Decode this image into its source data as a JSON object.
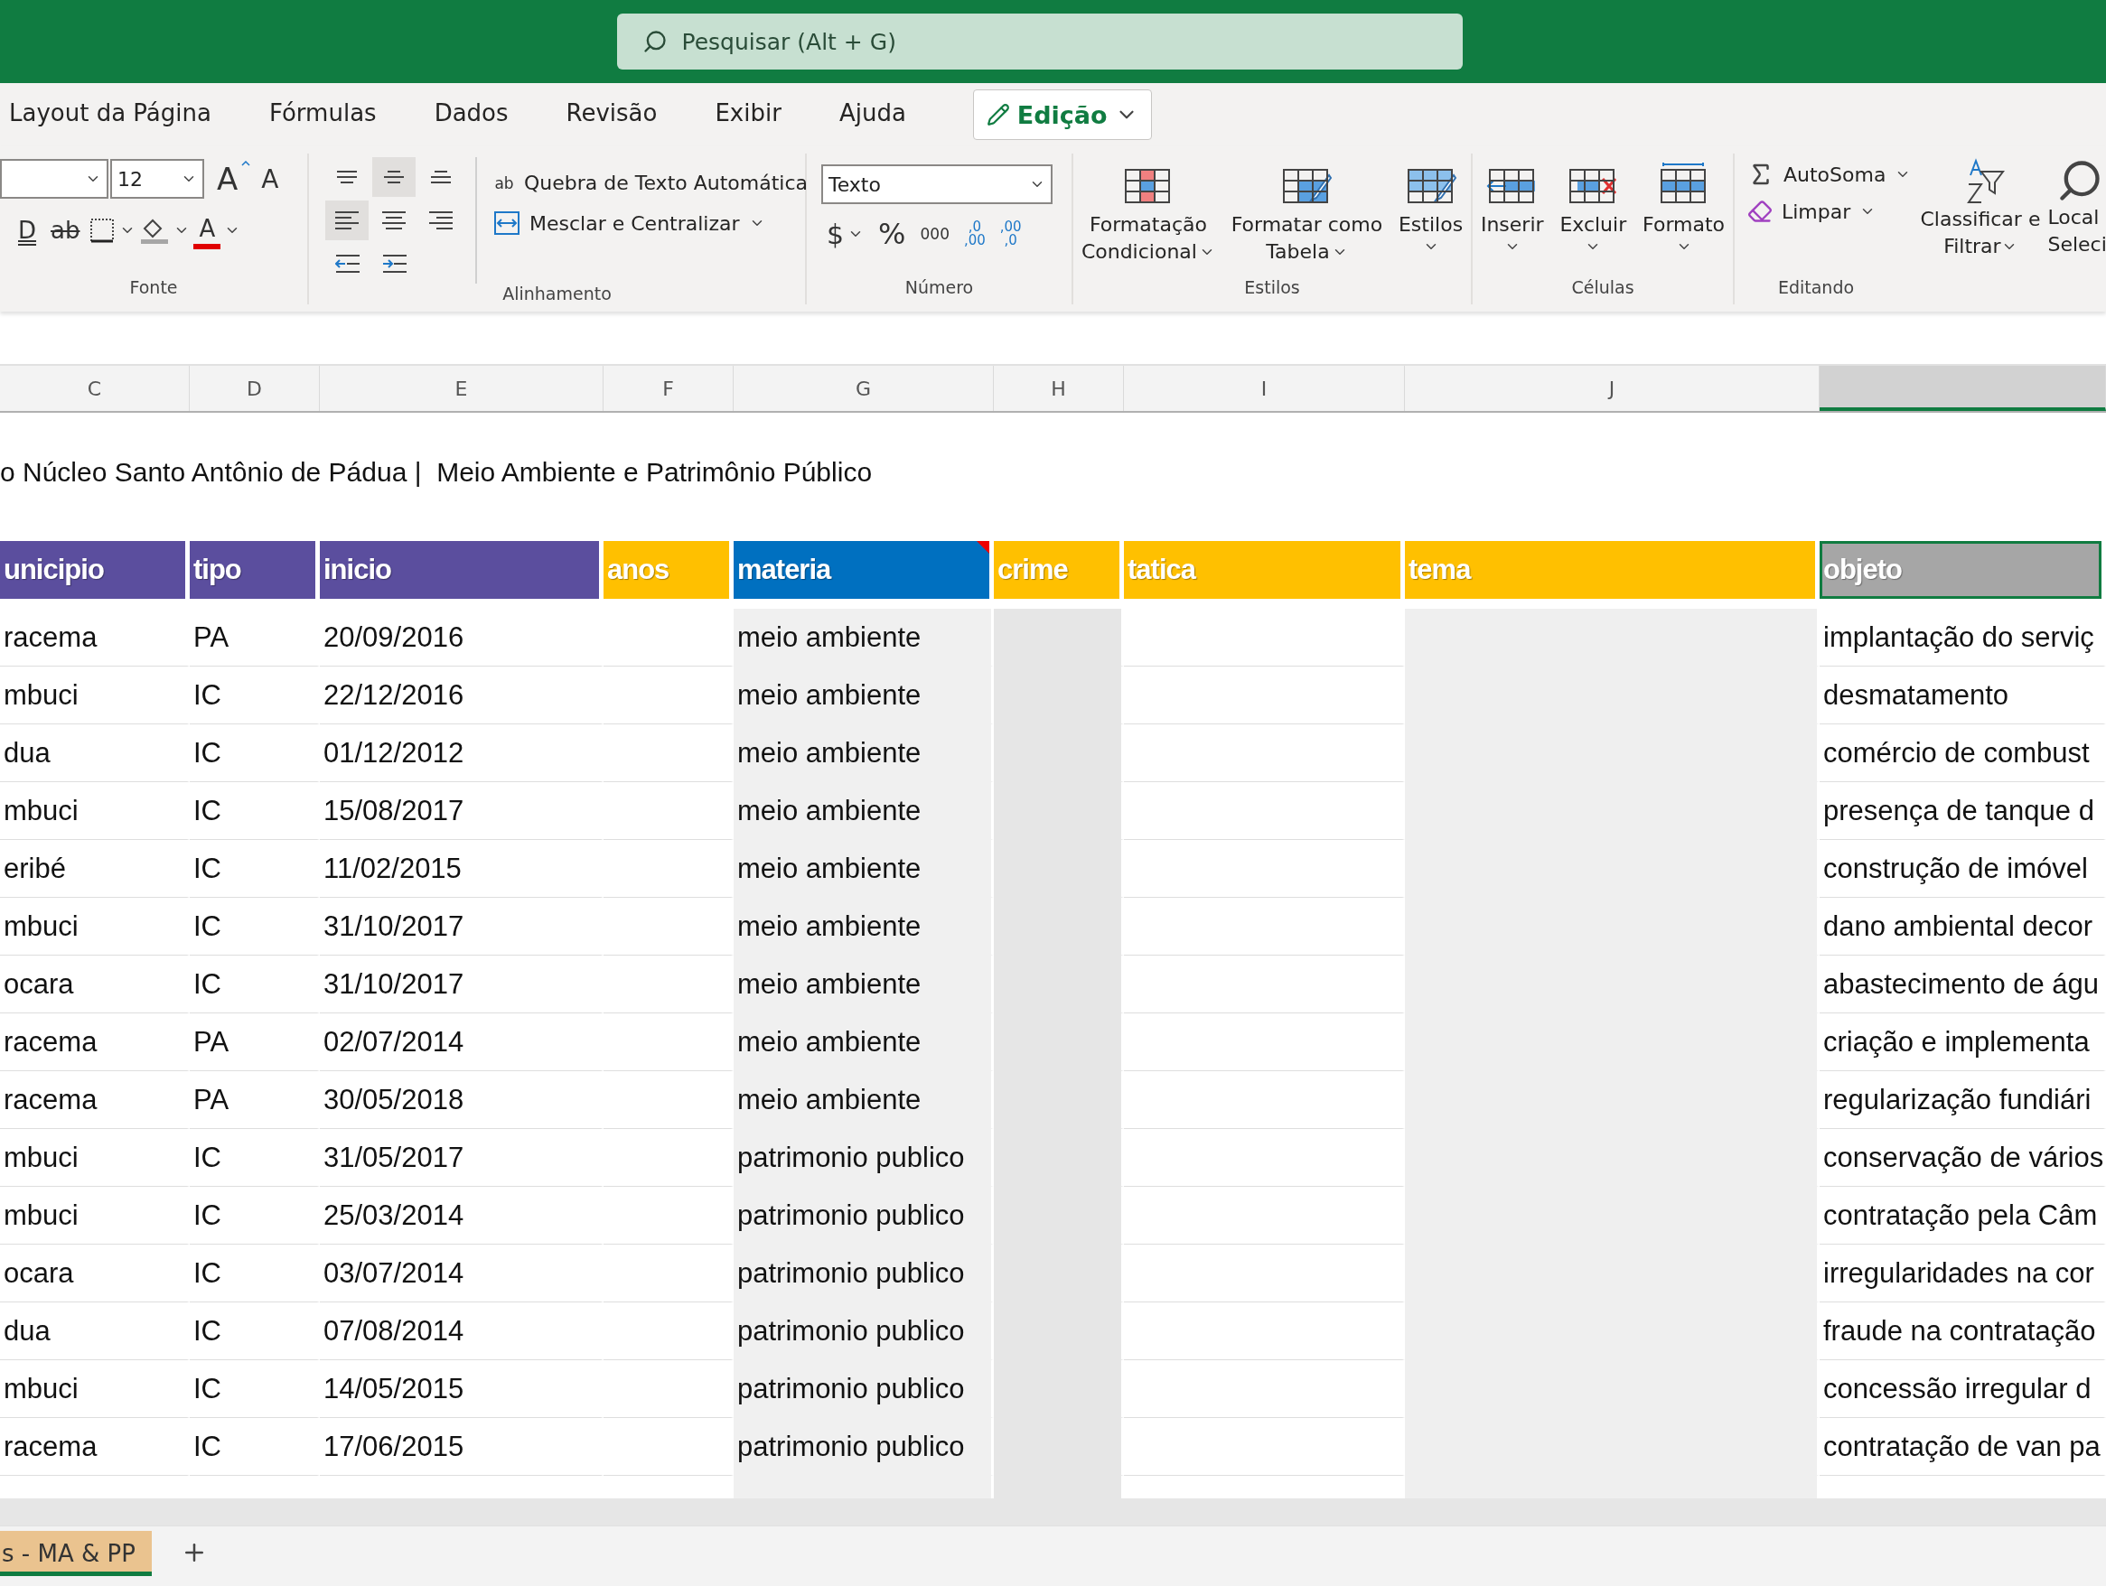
{
  "search": {
    "placeholder": "Pesquisar (Alt + G)"
  },
  "menu": {
    "tabs": [
      {
        "label": "Layout da Página",
        "selected": false
      },
      {
        "label": "Fórmulas",
        "selected": false
      },
      {
        "label": "Dados",
        "selected": false
      },
      {
        "label": "Revisão",
        "selected": false
      },
      {
        "label": "Exibir",
        "selected": false
      },
      {
        "label": "Ajuda",
        "selected": false
      }
    ],
    "mode_button": "Edição"
  },
  "ribbon": {
    "font": {
      "label": "Fonte",
      "size": "12",
      "grow": "A",
      "shrink": "A",
      "underline": "D",
      "strike": "ab",
      "color_letter": "A"
    },
    "alignment": {
      "label": "Alinhamento",
      "buttons": [
        {
          "kind": "top",
          "selected": false
        },
        {
          "kind": "middle",
          "selected": true
        },
        {
          "kind": "bottom",
          "selected": false
        },
        {
          "kind": "left",
          "selected": true
        },
        {
          "kind": "center",
          "selected": false
        },
        {
          "kind": "right",
          "selected": false
        },
        {
          "kind": "outdent",
          "selected": false
        },
        {
          "kind": "indent",
          "selected": false
        }
      ],
      "wrap": "Quebra de Texto Automática",
      "wrap_icon": "ab",
      "merge": "Mesclar e Centralizar"
    },
    "number": {
      "label": "Número",
      "format": "Texto",
      "currency": "$",
      "percent": "%",
      "thousands": "000",
      "increase": [
        ",0",
        ",00"
      ],
      "decrease": [
        ",00",
        ",0"
      ]
    },
    "styles": {
      "label": "Estilos",
      "buttons": [
        {
          "kind": "conditional",
          "lines": [
            "Formatação",
            "Condicional"
          ]
        },
        {
          "kind": "table",
          "lines": [
            "Formatar como",
            "Tabela"
          ]
        },
        {
          "kind": "styles",
          "lines": [
            "Estilos"
          ]
        }
      ]
    },
    "cells": {
      "label": "Células",
      "buttons": [
        {
          "kind": "insert",
          "lines": [
            "Inserir"
          ]
        },
        {
          "kind": "delete",
          "lines": [
            "Excluir"
          ]
        },
        {
          "kind": "format",
          "lines": [
            "Formato"
          ]
        }
      ]
    },
    "editing": {
      "label": "Editando",
      "autosum": "AutoSoma",
      "clear": "Limpar",
      "sort": [
        "Classificar e",
        "Filtrar"
      ],
      "find": [
        "Local",
        "Seleci"
      ]
    }
  },
  "sheet": {
    "title": "o Núcleo Santo Antônio de Pádua |  Meio Ambiente e Patrimônio Público",
    "columns": [
      {
        "letter": "C",
        "header": "unicipio",
        "color": "#5b4e9e",
        "selected": false,
        "has_note": false
      },
      {
        "letter": "D",
        "header": "tipo",
        "color": "#5b4e9e",
        "selected": false,
        "has_note": false
      },
      {
        "letter": "E",
        "header": "inicio",
        "color": "#5b4e9e",
        "selected": false,
        "has_note": false
      },
      {
        "letter": "F",
        "header": "anos",
        "color": "#ffc000",
        "selected": false,
        "has_note": false
      },
      {
        "letter": "G",
        "header": "materia",
        "color": "#0070c0",
        "selected": false,
        "has_note": true
      },
      {
        "letter": "H",
        "header": "crime",
        "color": "#ffc000",
        "selected": false,
        "has_note": false
      },
      {
        "letter": "I",
        "header": "tatica",
        "color": "#ffc000",
        "selected": false,
        "has_note": false
      },
      {
        "letter": "J",
        "header": "tema",
        "color": "#ffc000",
        "selected": false,
        "has_note": false
      },
      {
        "header": "objeto",
        "color": "#a6a6a6",
        "selected": true,
        "has_note": false
      }
    ],
    "rows": [
      [
        "racema",
        "PA",
        "20/09/2016",
        null,
        "meio ambiente",
        null,
        null,
        null,
        "implantação do serviç"
      ],
      [
        "mbuci",
        "IC",
        "22/12/2016",
        null,
        "meio ambiente",
        null,
        null,
        null,
        "desmatamento"
      ],
      [
        "dua",
        "IC",
        "01/12/2012",
        null,
        "meio ambiente",
        null,
        null,
        null,
        "comércio de combust"
      ],
      [
        "mbuci",
        "IC",
        "15/08/2017",
        null,
        "meio ambiente",
        null,
        null,
        null,
        "presença de tanque d"
      ],
      [
        "eribé",
        "IC",
        "11/02/2015",
        null,
        "meio ambiente",
        null,
        null,
        null,
        "construção de imóvel"
      ],
      [
        "mbuci",
        "IC",
        "31/10/2017",
        null,
        "meio ambiente",
        null,
        null,
        null,
        "dano ambiental decor"
      ],
      [
        "ocara",
        "IC",
        "31/10/2017",
        null,
        "meio ambiente",
        null,
        null,
        null,
        "abastecimento de águ"
      ],
      [
        "racema",
        "PA",
        "02/07/2014",
        null,
        "meio ambiente",
        null,
        null,
        null,
        "criação e implementa"
      ],
      [
        "racema",
        "PA",
        "30/05/2018",
        null,
        "meio ambiente",
        null,
        null,
        null,
        "regularização fundiári"
      ],
      [
        "mbuci",
        "IC",
        "31/05/2017",
        null,
        "patrimonio publico",
        null,
        null,
        null,
        "conservação de vários"
      ],
      [
        "mbuci",
        "IC",
        "25/03/2014",
        null,
        "patrimonio publico",
        null,
        null,
        null,
        "contratação pela Câm"
      ],
      [
        "ocara",
        "IC",
        "03/07/2014",
        null,
        "patrimonio publico",
        null,
        null,
        null,
        "irregularidades na cor"
      ],
      [
        "dua",
        "IC",
        "07/08/2014",
        null,
        "patrimonio publico",
        null,
        null,
        null,
        "fraude na contratação"
      ],
      [
        "mbuci",
        "IC",
        "14/05/2015",
        null,
        "patrimonio publico",
        null,
        null,
        null,
        "concessão irregular d"
      ],
      [
        "racema",
        "IC",
        "17/06/2015",
        null,
        "patrimonio publico",
        null,
        null,
        null,
        "contratação de van pa"
      ]
    ]
  },
  "sheet_tabs": [
    {
      "label": "s - MA & PP",
      "selected": true
    }
  ]
}
